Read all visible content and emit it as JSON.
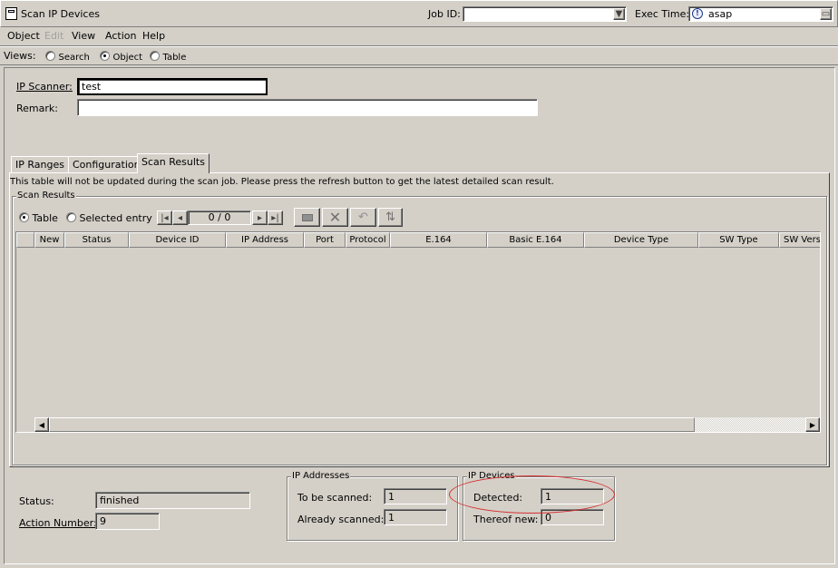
{
  "window": {
    "title": "Scan IP Devices"
  },
  "header": {
    "job_id_label": "Job ID:",
    "job_id_value": "",
    "exec_time_label": "Exec Time:",
    "exec_time_value": "asap"
  },
  "menu": [
    "Object",
    "Edit",
    "View",
    "Action",
    "Help"
  ],
  "views": {
    "label": "Views:",
    "options": [
      "Search",
      "Object",
      "Table"
    ],
    "selected": "Object"
  },
  "form": {
    "scanner_label": "IP Scanner:",
    "scanner_value": "test",
    "remark_label": "Remark:",
    "remark_value": ""
  },
  "tabs": [
    "IP Ranges",
    "Configuration",
    "Scan Results"
  ],
  "active_tab": "Scan Results",
  "info_text": "This table will not be updated during the scan job. Please press the refresh button to get the latest detailed scan result.",
  "scan_results": {
    "group_label": "Scan Results",
    "mode_table": "Table",
    "mode_selected": "Selected entry",
    "pager": "0 / 0",
    "columns": [
      "New",
      "Status",
      "Device ID",
      "IP Address",
      "Port",
      "Protocol",
      "E.164",
      "Basic E.164",
      "Device Type",
      "SW Type",
      "SW Vers"
    ]
  },
  "status": {
    "status_label": "Status:",
    "status_value": "finished",
    "action_label": "Action Number:",
    "action_value": "9"
  },
  "ip_addresses": {
    "group_label": "IP Addresses",
    "to_be_scanned_label": "To be scanned:",
    "to_be_scanned_value": "1",
    "already_scanned_label": "Already scanned:",
    "already_scanned_value": "1"
  },
  "ip_devices": {
    "group_label": "IP Devices",
    "detected_label": "Detected:",
    "detected_value": "1",
    "thereof_new_label": "Thereof new:",
    "thereof_new_value": "0"
  },
  "colors": {
    "annotation_circle": "#d62f2f",
    "window_bg": "#d4d0c8"
  }
}
